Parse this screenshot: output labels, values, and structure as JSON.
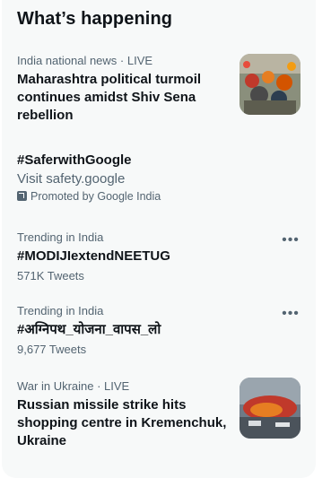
{
  "section": {
    "title": "What’s happening"
  },
  "trends": [
    {
      "meta": "India national news · LIVE",
      "headline": "Maharashtra political turmoil continues amidst Shiv Sena rebellion",
      "thumbnail": "crowd-photo"
    },
    {
      "headline": "#SaferwithGoogle",
      "subtitle": "Visit safety.google",
      "promoted": "Promoted by Google India",
      "promo_icon": "external-arrow-icon"
    },
    {
      "meta": "Trending in India",
      "headline": "#MODIJIextendNEETUG",
      "count": "571K Tweets",
      "more_icon": "more-icon"
    },
    {
      "meta": "Trending in India",
      "headline": "#अग्निपथ_योजना_वापस_लो",
      "count": "9,677 Tweets",
      "more_icon": "more-icon"
    },
    {
      "meta": "War in Ukraine · LIVE",
      "headline": "Russian missile strike hits shopping centre in Kremenchuk, Ukraine",
      "thumbnail": "fire-photo"
    }
  ],
  "colors": {
    "panel_bg": "#f7f9f9",
    "text": "#0f1419",
    "secondary": "#536471"
  }
}
